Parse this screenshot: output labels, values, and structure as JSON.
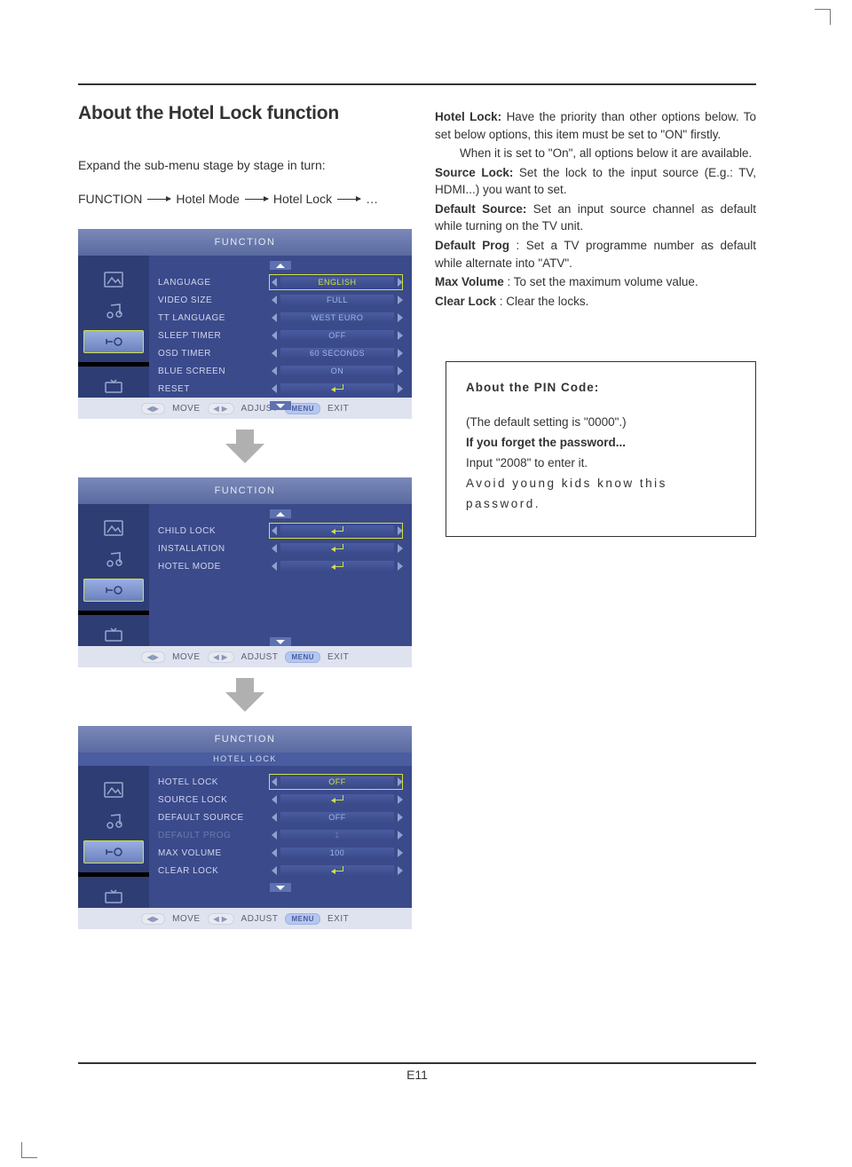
{
  "page_title": "About the Hotel Lock function",
  "intro": "Expand the sub-menu stage by stage in turn:",
  "crumbs": [
    "FUNCTION",
    "Hotel Mode",
    "Hotel Lock",
    "…"
  ],
  "footer_labels": {
    "move": "MOVE",
    "adjust": "ADJUST",
    "menu": "MENU",
    "exit": "EXIT"
  },
  "menu1": {
    "title": "FUNCTION",
    "rows": [
      {
        "label": "LANGUAGE",
        "value": "ENGLISH",
        "type": "text",
        "hilite": true
      },
      {
        "label": "VIDEO SIZE",
        "value": "FULL",
        "type": "text"
      },
      {
        "label": "TT LANGUAGE",
        "value": "WEST EURO",
        "type": "text"
      },
      {
        "label": "SLEEP TIMER",
        "value": "OFF",
        "type": "text"
      },
      {
        "label": "OSD TIMER",
        "value": "60 SECONDS",
        "type": "text"
      },
      {
        "label": "BLUE SCREEN",
        "value": "ON",
        "type": "text"
      },
      {
        "label": "RESET",
        "value": "",
        "type": "enter"
      }
    ]
  },
  "menu2": {
    "title": "FUNCTION",
    "rows": [
      {
        "label": "CHILD LOCK",
        "value": "",
        "type": "enter",
        "hilite": true,
        "style": "on"
      },
      {
        "label": "INSTALLATION",
        "value": "",
        "type": "enter"
      },
      {
        "label": "HOTEL MODE",
        "value": "",
        "type": "enter"
      }
    ]
  },
  "menu3": {
    "title": "FUNCTION",
    "subtitle": "HOTEL LOCK",
    "rows": [
      {
        "label": "HOTEL LOCK",
        "value": "OFF",
        "type": "text",
        "hilite": true,
        "style": "on"
      },
      {
        "label": "SOURCE LOCK",
        "value": "",
        "type": "enter"
      },
      {
        "label": "DEFAULT SOURCE",
        "value": "OFF",
        "type": "text"
      },
      {
        "label": "DEFAULT PROG",
        "value": "1",
        "type": "text",
        "dim": true
      },
      {
        "label": "MAX VOLUME",
        "value": "100",
        "type": "text"
      },
      {
        "label": "CLEAR LOCK",
        "value": "",
        "type": "enter"
      }
    ]
  },
  "definitions": [
    {
      "term": "Hotel Lock:",
      "body": "Have the priority than other options below. To set below options, this item must be set to \"ON\" firstly.",
      "extra": "When it is set to \"On\", all options below it are available."
    },
    {
      "term": "Source Lock:",
      "body": "Set the lock to the input source (E.g.: TV, HDMI...) you want to set."
    },
    {
      "term": "Default Source:",
      "body": "Set an input source channel as default while turning on the TV unit."
    },
    {
      "term": "Default Prog",
      "body": ": Set a TV programme number as default while alternate into \"ATV\"."
    },
    {
      "term": "Max Volume",
      "body": ": To set the maximum volume value."
    },
    {
      "term": "Clear Lock",
      "body": ": Clear the locks."
    }
  ],
  "pin": {
    "title": "About the PIN Code:",
    "l1": "(The default setting is \"0000\".)",
    "l2": "If you forget the password...",
    "l3": "Input \"2008\" to enter it.",
    "l4": "Avoid young kids know this password."
  },
  "page_num": "E11"
}
